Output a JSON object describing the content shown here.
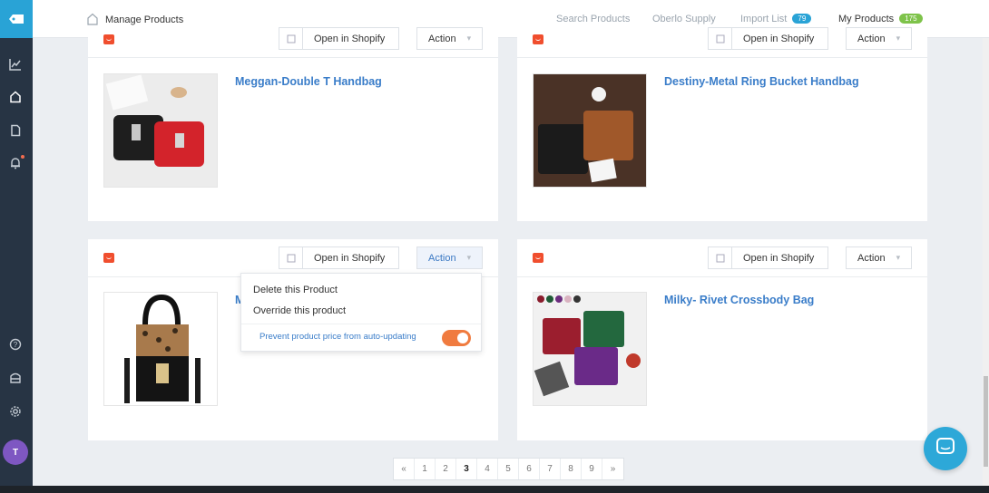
{
  "header": {
    "title": "Manage Products",
    "nav": [
      {
        "label": "Search Products",
        "badge": null
      },
      {
        "label": "Oberlo Supply",
        "badge": null
      },
      {
        "label": "Import List",
        "badge": "79"
      },
      {
        "label": "My Products",
        "badge": "175"
      }
    ]
  },
  "sidebar": {
    "avatar_initial": "T",
    "icons": [
      "analytics-icon",
      "home-icon",
      "orders-icon",
      "notifications-icon",
      "help-icon",
      "store-icon",
      "settings-icon"
    ]
  },
  "card_actions": {
    "open_in_shopify": "Open in Shopify",
    "action": "Action"
  },
  "products": [
    {
      "name": "Meggan-Double T Handbag"
    },
    {
      "name": "Destiny-Metal Ring Bucket Handbag"
    },
    {
      "name": "M"
    },
    {
      "name": "Milky- Rivet Crossbody Bag"
    }
  ],
  "dropdown": {
    "delete": "Delete this Product",
    "override": "Override this product",
    "prevent_price": "Prevent product price from auto-updating",
    "prevent_price_enabled": true
  },
  "pagination": {
    "prev": "«",
    "pages": [
      "1",
      "2",
      "3",
      "4",
      "5",
      "6",
      "7",
      "8",
      "9"
    ],
    "current": "3",
    "next": "»"
  },
  "colors": {
    "accent": "#3a7dc9",
    "import_badge": "#29a3d6",
    "products_badge": "#7ec34a",
    "toggle": "#f07b3f",
    "shop_icon": "#f04e2e"
  }
}
